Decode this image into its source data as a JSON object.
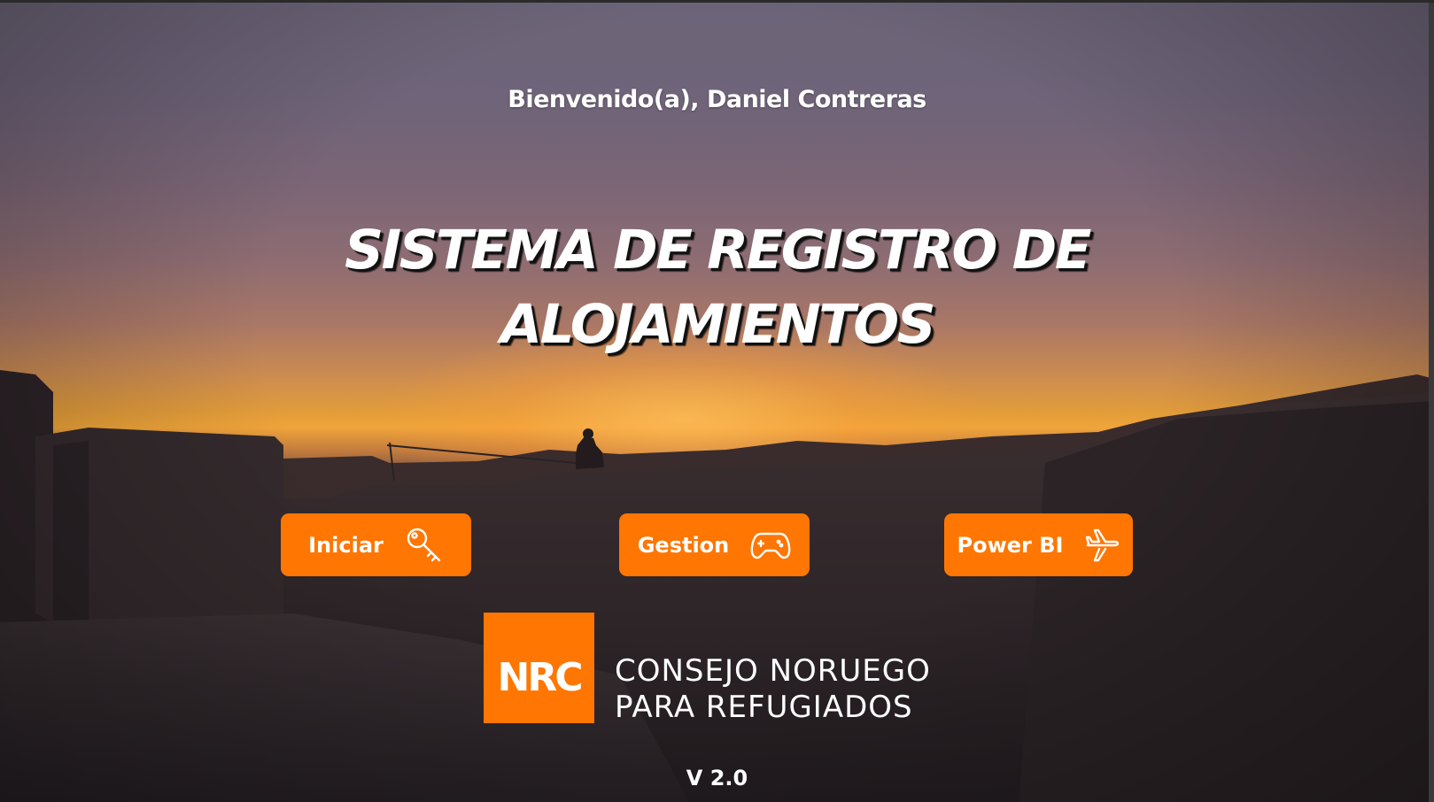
{
  "welcome": "Bienvenido(a), Daniel Contreras",
  "title": {
    "line1": "SISTEMA DE REGISTRO DE",
    "line2": "ALOJAMIENTOS"
  },
  "buttons": [
    {
      "label": "Iniciar",
      "icon": "key-icon"
    },
    {
      "label": "Gestion",
      "icon": "gamepad-icon"
    },
    {
      "label": "Power BI",
      "icon": "airplane-icon"
    }
  ],
  "brand": {
    "logo_text": "NRC",
    "org_line1": "CONSEJO NORUEGO",
    "org_line2": "PARA REFUGIADOS",
    "color": "#ff7602"
  },
  "version": "V 2.0",
  "background": {
    "description_colors": [
      "#6c6478",
      "#f0a43a",
      "#2d2529"
    ]
  }
}
